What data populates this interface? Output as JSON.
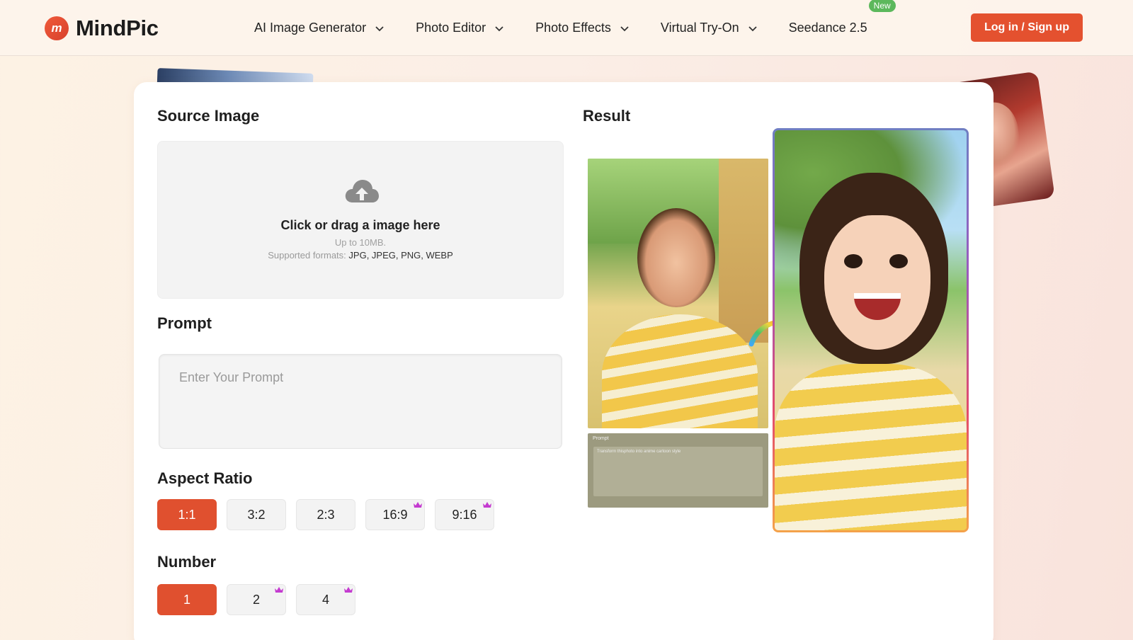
{
  "header": {
    "brand": "MindPic",
    "logo_glyph": "m",
    "nav": [
      {
        "label": "AI Image Generator",
        "has_dropdown": true
      },
      {
        "label": "Photo Editor",
        "has_dropdown": true
      },
      {
        "label": "Photo Effects",
        "has_dropdown": true
      },
      {
        "label": "Virtual Try-On",
        "has_dropdown": true
      },
      {
        "label": "Seedance 2.5",
        "has_dropdown": false,
        "badge": "New"
      }
    ],
    "login_label": "Log in / Sign up"
  },
  "source": {
    "title": "Source Image",
    "upload_icon": "cloud-upload-icon",
    "upload_main": "Click or drag a image here",
    "upload_limit": "Up to 10MB.",
    "formats_label": "Supported formats:",
    "formats": "JPG, JPEG, PNG, WEBP"
  },
  "prompt": {
    "title": "Prompt",
    "placeholder": "Enter Your Prompt",
    "value": ""
  },
  "aspect_ratio": {
    "title": "Aspect Ratio",
    "options": [
      {
        "label": "1:1",
        "selected": true,
        "premium": false
      },
      {
        "label": "3:2",
        "selected": false,
        "premium": false
      },
      {
        "label": "2:3",
        "selected": false,
        "premium": false
      },
      {
        "label": "16:9",
        "selected": false,
        "premium": true
      },
      {
        "label": "9:16",
        "selected": false,
        "premium": true
      }
    ]
  },
  "number": {
    "title": "Number",
    "options": [
      {
        "label": "1",
        "selected": true,
        "premium": false
      },
      {
        "label": "2",
        "selected": false,
        "premium": true
      },
      {
        "label": "4",
        "selected": false,
        "premium": true
      }
    ]
  },
  "result": {
    "title": "Result",
    "example_prompt_label": "Prompt",
    "example_prompt_text": "Transform thisphoto into anime cartoon style"
  },
  "colors": {
    "accent": "#e4512f",
    "badge_green": "#5cb85c",
    "crown": "#c43bd0"
  }
}
